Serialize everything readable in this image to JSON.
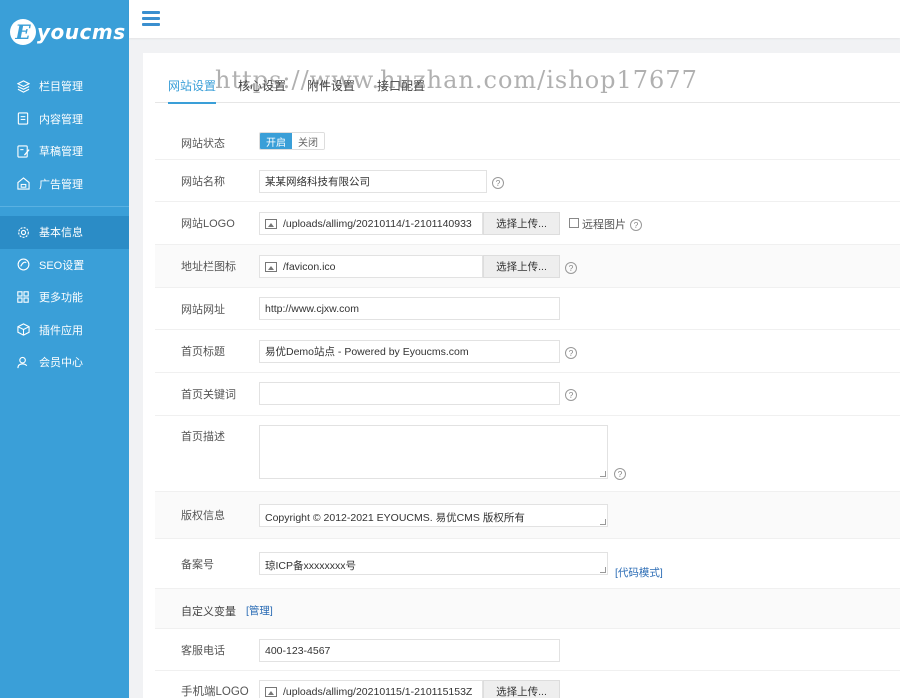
{
  "brand": {
    "logo_letter": "E",
    "logo_text": "youcms"
  },
  "sidebar": {
    "group1": [
      {
        "label": "栏目管理",
        "icon": "layers-icon"
      },
      {
        "label": "内容管理",
        "icon": "document-icon"
      },
      {
        "label": "草稿管理",
        "icon": "edit-document-icon"
      },
      {
        "label": "广告管理",
        "icon": "home-ad-icon"
      }
    ],
    "group2": [
      {
        "label": "基本信息",
        "icon": "gear-icon",
        "active": true
      },
      {
        "label": "SEO设置",
        "icon": "seo-circle-icon"
      },
      {
        "label": "更多功能",
        "icon": "grid-icon"
      },
      {
        "label": "插件应用",
        "icon": "cube-icon"
      },
      {
        "label": "会员中心",
        "icon": "user-icon"
      }
    ]
  },
  "tabs": [
    "网站设置",
    "核心设置",
    "附件设置",
    "接口配置"
  ],
  "watermark": "https://www.huzhan.com/ishop17677",
  "form": {
    "site_status": {
      "label": "网站状态",
      "on": "开启",
      "off": "关闭"
    },
    "site_name": {
      "label": "网站名称",
      "value": "某某网络科技有限公司"
    },
    "site_logo": {
      "label": "网站LOGO",
      "value": "/uploads/allimg/20210114/1-2101140933",
      "button": "选择上传...",
      "remote": "远程图片"
    },
    "favicon": {
      "label": "地址栏图标",
      "value": "/favicon.ico",
      "button": "选择上传..."
    },
    "site_url": {
      "label": "网站网址",
      "value": "http://www.cjxw.com"
    },
    "home_title": {
      "label": "首页标题",
      "value": "易优Demo站点 -  Powered by Eyoucms.com"
    },
    "home_keywords": {
      "label": "首页关键词",
      "value": ""
    },
    "home_desc": {
      "label": "首页描述",
      "value": ""
    },
    "copyright": {
      "label": "版权信息",
      "value": "Copyright © 2012-2021 EYOUCMS. 易优CMS 版权所有"
    },
    "icp": {
      "label": "备案号",
      "value": "琼ICP备xxxxxxxx号",
      "link": "[代码模式]"
    },
    "custom_vars": {
      "label": "自定义变量",
      "link": "[管理]"
    },
    "phone": {
      "label": "客服电话",
      "value": "400-123-4567"
    },
    "mobile_logo": {
      "label": "手机端LOGO",
      "value": "/uploads/allimg/20210115/1-210115153Z",
      "button": "选择上传..."
    }
  },
  "help_glyph": "?",
  "colors": {
    "sidebar": "#3a9fd8",
    "sidebar_active": "#2b8cc6",
    "accent": "#3a9fd8",
    "link": "#2b6cb5"
  }
}
